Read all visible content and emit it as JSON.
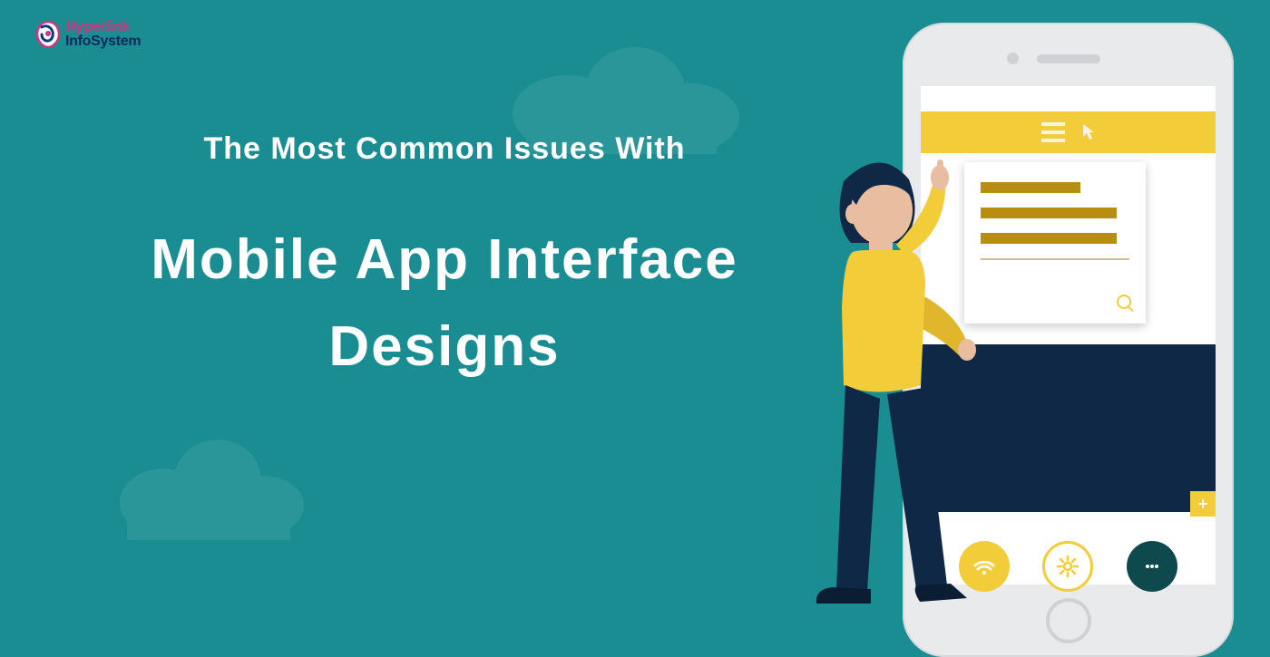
{
  "logo": {
    "line1": "Hyperlink",
    "line2": "InfoSystem"
  },
  "headline": {
    "subtitle": "The Most Common Issues With",
    "title": "Mobile App Interface Designs"
  },
  "phone_ui": {
    "plus_symbol": "+"
  },
  "icons": {
    "hamburger": "hamburger-menu-icon",
    "cursor": "cursor-icon",
    "search": "search-icon",
    "wifi": "wifi-icon",
    "gear": "gear-icon",
    "chat": "chat-icon"
  },
  "colors": {
    "background": "#1a8d92",
    "accent_yellow": "#f3cc3a",
    "dark_navy": "#0e2846",
    "cloud": "#2a969a",
    "logo_pink": "#d03580",
    "logo_navy": "#0b2a5b"
  }
}
